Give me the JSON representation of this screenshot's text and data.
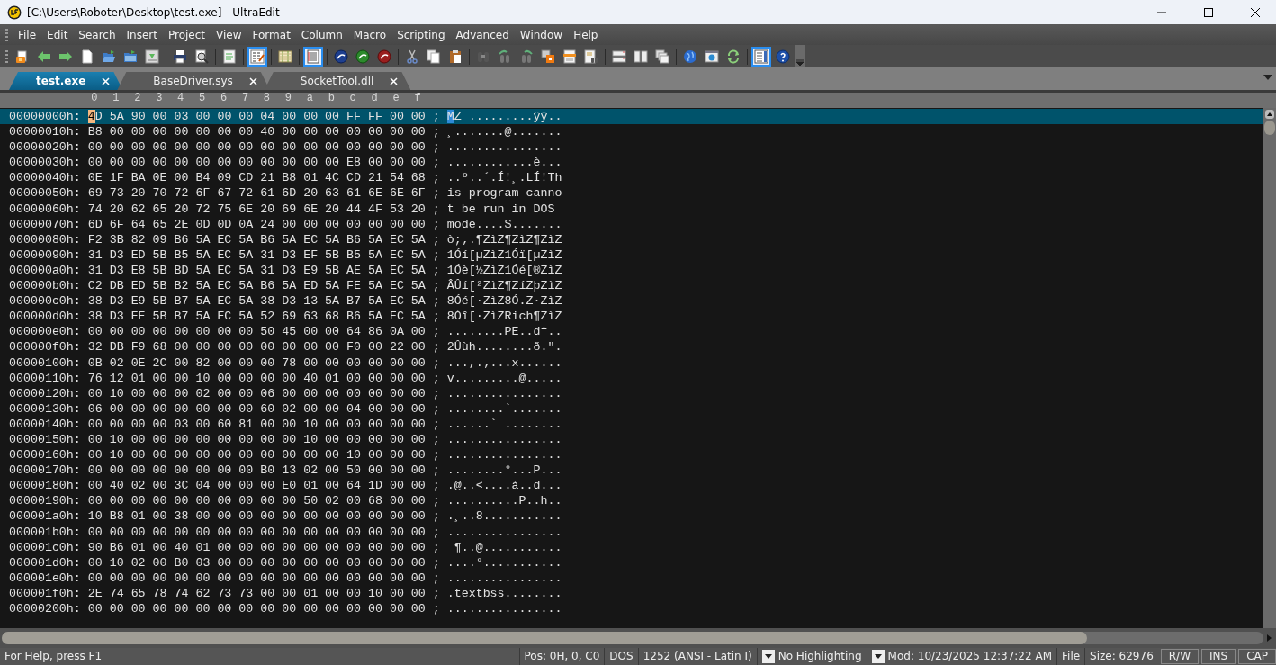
{
  "window": {
    "title": "[C:\\Users\\Roboter\\Desktop\\test.exe] - UltraEdit"
  },
  "menu": [
    "File",
    "Edit",
    "Search",
    "Insert",
    "Project",
    "View",
    "Format",
    "Column",
    "Macro",
    "Scripting",
    "Advanced",
    "Window",
    "Help"
  ],
  "toolbar": [
    {
      "pressed": false
    },
    {
      "pressed": false
    },
    {
      "pressed": false
    },
    {
      "pressed": false
    },
    {
      "pressed": false
    },
    {
      "pressed": false
    },
    {
      "pressed": false
    },
    {
      "pressed": false
    },
    {
      "pressed": false
    },
    {
      "pressed": false
    },
    {
      "pressed": true
    },
    {
      "pressed": false
    },
    {
      "pressed": true
    },
    {
      "pressed": false
    },
    {
      "pressed": false
    },
    {
      "pressed": false
    },
    {
      "pressed": false
    },
    {
      "pressed": false
    },
    {
      "pressed": false
    },
    {
      "pressed": false
    },
    {
      "pressed": false
    },
    {
      "pressed": false
    },
    {
      "pressed": false
    },
    {
      "pressed": false
    },
    {
      "pressed": false
    },
    {
      "pressed": false
    },
    {
      "pressed": false
    },
    {
      "pressed": false
    },
    {
      "pressed": false
    },
    {
      "pressed": false
    },
    {
      "pressed": false
    },
    {
      "pressed": true
    },
    {
      "pressed": false
    }
  ],
  "tabs": [
    {
      "label": "test.exe",
      "selected": true
    },
    {
      "label": "BaseDriver.sys",
      "selected": false
    },
    {
      "label": "SocketTool.dll",
      "selected": false
    }
  ],
  "ruler": [
    "0",
    "1",
    "2",
    "3",
    "4",
    "5",
    "6",
    "7",
    "8",
    "9",
    "a",
    "b",
    "c",
    "d",
    "e",
    "f"
  ],
  "rows": [
    {
      "offset": "00000000h:",
      "hex": "4D 5A 90 00 03 00 00 00 04 00 00 00 FF FF 00 00",
      "sep": ";",
      "ascii": "MZ .........ÿÿ..",
      "selected": true
    },
    {
      "offset": "00000010h:",
      "hex": "B8 00 00 00 00 00 00 00 40 00 00 00 00 00 00 00",
      "sep": ";",
      "ascii": "¸.......@.......",
      "selected": false
    },
    {
      "offset": "00000020h:",
      "hex": "00 00 00 00 00 00 00 00 00 00 00 00 00 00 00 00",
      "sep": ";",
      "ascii": "................",
      "selected": false
    },
    {
      "offset": "00000030h:",
      "hex": "00 00 00 00 00 00 00 00 00 00 00 00 E8 00 00 00",
      "sep": ";",
      "ascii": "............è...",
      "selected": false
    },
    {
      "offset": "00000040h:",
      "hex": "0E 1F BA 0E 00 B4 09 CD 21 B8 01 4C CD 21 54 68",
      "sep": ";",
      "ascii": "..º..´.Í!¸.LÍ!Th",
      "selected": false
    },
    {
      "offset": "00000050h:",
      "hex": "69 73 20 70 72 6F 67 72 61 6D 20 63 61 6E 6E 6F",
      "sep": ";",
      "ascii": "is program canno",
      "selected": false
    },
    {
      "offset": "00000060h:",
      "hex": "74 20 62 65 20 72 75 6E 20 69 6E 20 44 4F 53 20",
      "sep": ";",
      "ascii": "t be run in DOS ",
      "selected": false
    },
    {
      "offset": "00000070h:",
      "hex": "6D 6F 64 65 2E 0D 0D 0A 24 00 00 00 00 00 00 00",
      "sep": ";",
      "ascii": "mode....$.......",
      "selected": false
    },
    {
      "offset": "00000080h:",
      "hex": "F2 3B 82 09 B6 5A EC 5A B6 5A EC 5A B6 5A EC 5A",
      "sep": ";",
      "ascii": "ò;‚.¶ZìZ¶ZìZ¶ZìZ",
      "selected": false
    },
    {
      "offset": "00000090h:",
      "hex": "31 D3 ED 5B B5 5A EC 5A 31 D3 EF 5B B5 5A EC 5A",
      "sep": ";",
      "ascii": "1Óí[µZìZ1Óï[µZìZ",
      "selected": false
    },
    {
      "offset": "000000a0h:",
      "hex": "31 D3 E8 5B BD 5A EC 5A 31 D3 E9 5B AE 5A EC 5A",
      "sep": ";",
      "ascii": "1Óè[½ZìZ1Óé[®ZìZ",
      "selected": false
    },
    {
      "offset": "000000b0h:",
      "hex": "C2 DB ED 5B B2 5A EC 5A B6 5A ED 5A FE 5A EC 5A",
      "sep": ";",
      "ascii": "ÂÛí[²ZìZ¶ZíZþZìZ",
      "selected": false
    },
    {
      "offset": "000000c0h:",
      "hex": "38 D3 E9 5B B7 5A EC 5A 38 D3 13 5A B7 5A EC 5A",
      "sep": ";",
      "ascii": "8Óé[·ZìZ8Ó.Z·ZìZ",
      "selected": false
    },
    {
      "offset": "000000d0h:",
      "hex": "38 D3 EE 5B B7 5A EC 5A 52 69 63 68 B6 5A EC 5A",
      "sep": ";",
      "ascii": "8Óî[·ZìZRich¶ZìZ",
      "selected": false
    },
    {
      "offset": "000000e0h:",
      "hex": "00 00 00 00 00 00 00 00 50 45 00 00 64 86 0A 00",
      "sep": ";",
      "ascii": "........PE..d†..",
      "selected": false
    },
    {
      "offset": "000000f0h:",
      "hex": "32 DB F9 68 00 00 00 00 00 00 00 00 F0 00 22 00",
      "sep": ";",
      "ascii": "2Ûùh........ð.\".",
      "selected": false
    },
    {
      "offset": "00000100h:",
      "hex": "0B 02 0E 2C 00 82 00 00 00 78 00 00 00 00 00 00",
      "sep": ";",
      "ascii": "...,.‚...x......",
      "selected": false
    },
    {
      "offset": "00000110h:",
      "hex": "76 12 01 00 00 10 00 00 00 00 40 01 00 00 00 00",
      "sep": ";",
      "ascii": "v.........@.....",
      "selected": false
    },
    {
      "offset": "00000120h:",
      "hex": "00 10 00 00 00 02 00 00 06 00 00 00 00 00 00 00",
      "sep": ";",
      "ascii": "................",
      "selected": false
    },
    {
      "offset": "00000130h:",
      "hex": "06 00 00 00 00 00 00 00 60 02 00 00 04 00 00 00",
      "sep": ";",
      "ascii": "........`.......",
      "selected": false
    },
    {
      "offset": "00000140h:",
      "hex": "00 00 00 00 03 00 60 81 00 00 10 00 00 00 00 00",
      "sep": ";",
      "ascii": "......` ........",
      "selected": false
    },
    {
      "offset": "00000150h:",
      "hex": "00 10 00 00 00 00 00 00 00 00 10 00 00 00 00 00",
      "sep": ";",
      "ascii": "................",
      "selected": false
    },
    {
      "offset": "00000160h:",
      "hex": "00 10 00 00 00 00 00 00 00 00 00 00 10 00 00 00",
      "sep": ";",
      "ascii": "................",
      "selected": false
    },
    {
      "offset": "00000170h:",
      "hex": "00 00 00 00 00 00 00 00 B0 13 02 00 50 00 00 00",
      "sep": ";",
      "ascii": "........°...P...",
      "selected": false
    },
    {
      "offset": "00000180h:",
      "hex": "00 40 02 00 3C 04 00 00 00 E0 01 00 64 1D 00 00",
      "sep": ";",
      "ascii": ".@..<....à..d...",
      "selected": false
    },
    {
      "offset": "00000190h:",
      "hex": "00 00 00 00 00 00 00 00 00 00 50 02 00 68 00 00",
      "sep": ";",
      "ascii": "..........P..h..",
      "selected": false
    },
    {
      "offset": "000001a0h:",
      "hex": "10 B8 01 00 38 00 00 00 00 00 00 00 00 00 00 00",
      "sep": ";",
      "ascii": ".¸..8...........",
      "selected": false
    },
    {
      "offset": "000001b0h:",
      "hex": "00 00 00 00 00 00 00 00 00 00 00 00 00 00 00 00",
      "sep": ";",
      "ascii": "................",
      "selected": false
    },
    {
      "offset": "000001c0h:",
      "hex": "90 B6 01 00 40 01 00 00 00 00 00 00 00 00 00 00",
      "sep": ";",
      "ascii": " ¶..@...........",
      "selected": false
    },
    {
      "offset": "000001d0h:",
      "hex": "00 10 02 00 B0 03 00 00 00 00 00 00 00 00 00 00",
      "sep": ";",
      "ascii": "....°...........",
      "selected": false
    },
    {
      "offset": "000001e0h:",
      "hex": "00 00 00 00 00 00 00 00 00 00 00 00 00 00 00 00",
      "sep": ";",
      "ascii": "................",
      "selected": false
    },
    {
      "offset": "000001f0h:",
      "hex": "2E 74 65 78 74 62 73 73 00 00 01 00 00 10 00 00",
      "sep": ";",
      "ascii": ".textbss........",
      "selected": false
    },
    {
      "offset": "00000200h:",
      "hex": "00 00 00 00 00 00 00 00 00 00 00 00 00 00 00 00",
      "sep": ";",
      "ascii": "................",
      "selected": false
    }
  ],
  "status_bar": [
    {
      "text": "For Help, press F1",
      "kind": "plain"
    },
    {
      "text": "Pos: 0H, 0, C0",
      "kind": "plain"
    },
    {
      "text": "DOS",
      "kind": "plain"
    },
    {
      "text": "1252  (ANSI - Latin I)",
      "kind": "plain"
    },
    {
      "text": "No Highlighting",
      "kind": "combo"
    },
    {
      "text": "Mod: 10/23/2025 12:37:22 AM",
      "kind": "combo"
    },
    {
      "text": "File",
      "kind": "plain"
    },
    {
      "text": "Size: 62976",
      "kind": "plain"
    },
    {
      "text": "R/W",
      "kind": "key"
    },
    {
      "text": "INS",
      "kind": "key"
    },
    {
      "text": "CAP",
      "kind": "key"
    }
  ]
}
